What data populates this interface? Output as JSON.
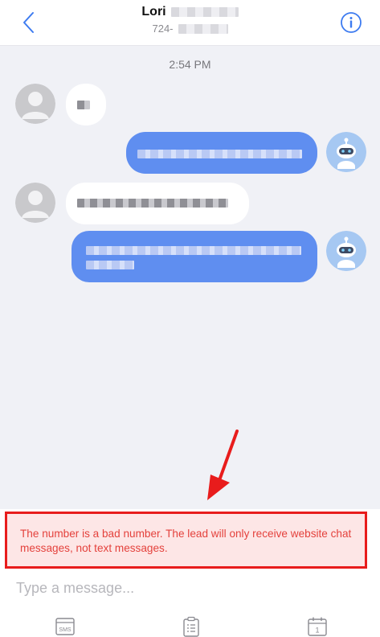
{
  "header": {
    "contact_name": "Lori",
    "contact_phone": "724-",
    "back_icon": "chevron-left-icon",
    "info_icon": "info-circle-icon",
    "accent_color": "#3d7bf0"
  },
  "chat": {
    "timestamp": "2:54 PM",
    "messages": [
      {
        "direction": "incoming",
        "sender": "contact",
        "redacted": true
      },
      {
        "direction": "outgoing",
        "sender": "bot",
        "redacted": true
      },
      {
        "direction": "incoming",
        "sender": "contact",
        "redacted": true
      },
      {
        "direction": "outgoing",
        "sender": "bot",
        "redacted": true
      }
    ],
    "outgoing_bubble_color": "#5f8ef0",
    "incoming_bubble_color": "#ffffff",
    "background_color": "#f0f1f6"
  },
  "warning": {
    "text": "The number is a bad number. The lead will only receive website chat messages, not text messages.",
    "text_color": "#e4413c",
    "border_color": "#e81c1c"
  },
  "composer": {
    "placeholder": "Type a message...",
    "value": ""
  },
  "toolbar": {
    "items": [
      {
        "icon": "sms-icon",
        "label": "SMS"
      },
      {
        "icon": "clipboard-icon",
        "label": ""
      },
      {
        "icon": "calendar-icon",
        "label": "1"
      }
    ]
  }
}
